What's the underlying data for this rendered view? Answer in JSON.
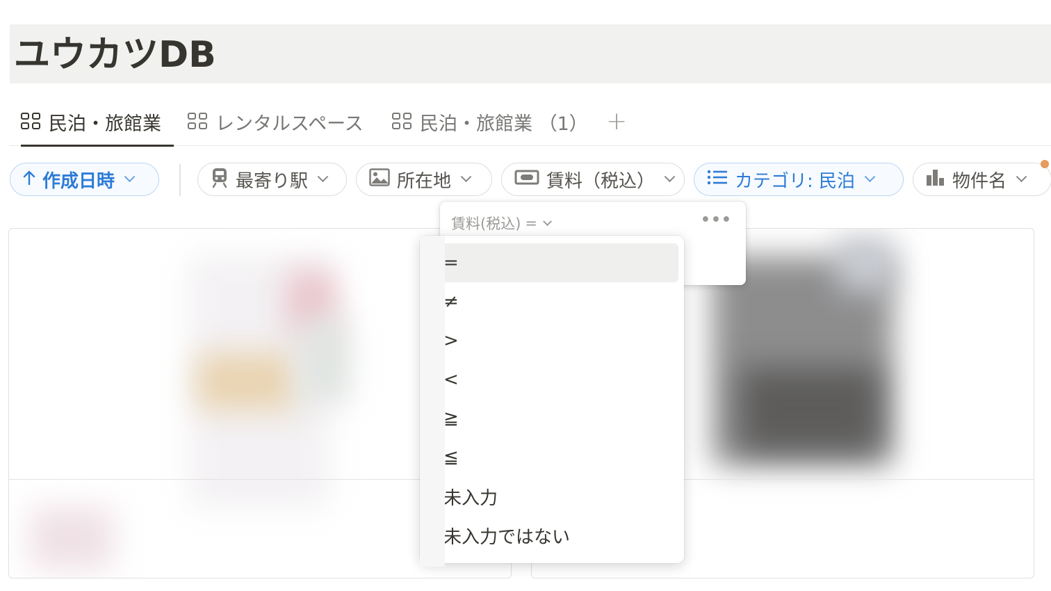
{
  "page": {
    "title": "ユウカツDB"
  },
  "tabs": [
    {
      "label": "民泊・旅館業",
      "active": true,
      "icon": "grid-icon"
    },
    {
      "label": "レンタルスペース",
      "active": false,
      "icon": "grid-icon"
    },
    {
      "label": "民泊・旅館業 （1）",
      "active": false,
      "icon": "grid-icon"
    }
  ],
  "add_tab_label": "+",
  "filters": {
    "sort": {
      "label": "作成日時",
      "icon": "arrow-up-icon"
    },
    "chips": [
      {
        "label": "最寄り駅",
        "icon": "train-icon"
      },
      {
        "label": "所在地",
        "icon": "image-icon"
      },
      {
        "label": "賃料（税込）",
        "icon": "money-icon"
      },
      {
        "label": "カテゴリ:  民泊",
        "icon": "list-icon",
        "active": true
      },
      {
        "label": "物件名",
        "icon": "chart-icon"
      }
    ]
  },
  "filter_popover": {
    "property_label": "賃料(税込)",
    "operator": "=",
    "more_label": "•••"
  },
  "operator_menu": {
    "items": [
      "=",
      "≠",
      ">",
      "<",
      "≧",
      "≦",
      "未入力",
      "未入力ではない"
    ],
    "selected_index": 0
  },
  "colors": {
    "accent": "#2e7bd6",
    "title_bar": "#f1f1ef",
    "notification_dot": "#e59b5e"
  }
}
